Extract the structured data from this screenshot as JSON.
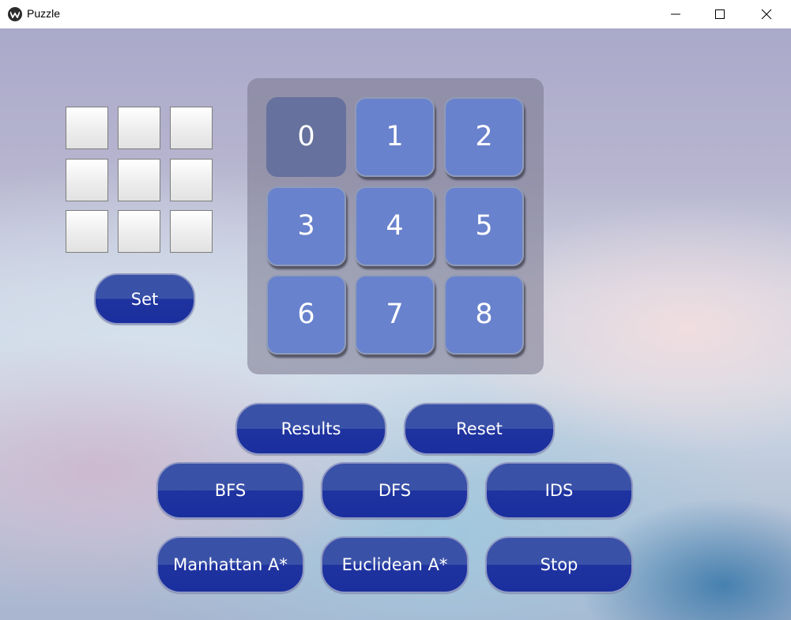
{
  "window": {
    "title": "Puzzle",
    "controls": [
      "minimize",
      "maximize",
      "close"
    ]
  },
  "input_grid": {
    "cells": [
      "",
      "",
      "",
      "",
      "",
      "",
      "",
      "",
      ""
    ]
  },
  "set_button": {
    "label": "Set"
  },
  "board": {
    "tiles": [
      "0",
      "1",
      "2",
      "3",
      "4",
      "5",
      "6",
      "7",
      "8"
    ],
    "empty_tile": "0"
  },
  "actions": {
    "results": "Results",
    "reset": "Reset",
    "bfs": "BFS",
    "dfs": "DFS",
    "ids": "IDS",
    "manhattan": "Manhattan A*",
    "euclidean": "Euclidean A*",
    "stop": "Stop"
  },
  "colors": {
    "tile": "#6982cd",
    "empty_tile": "#67719e",
    "button_top": "#3a51a8",
    "button_bottom": "#1f33a0"
  }
}
